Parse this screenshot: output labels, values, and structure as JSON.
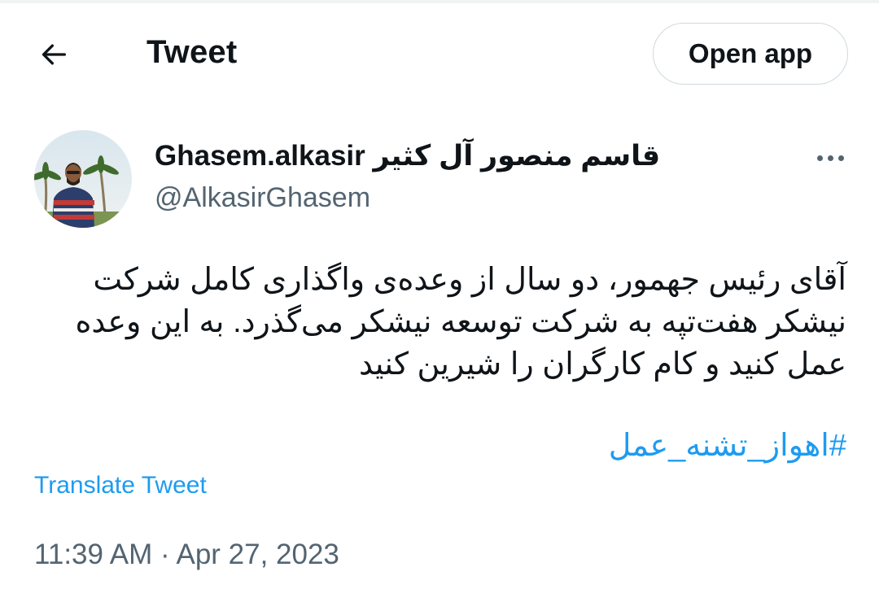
{
  "header": {
    "back_icon": "arrow-left-icon",
    "title": "Tweet",
    "open_app_label": "Open app"
  },
  "author": {
    "display_name_latin": "Ghasem.alkasir",
    "display_name_persian": "قاسم منصور آل کثیر",
    "handle": "@AlkasirGhasem",
    "avatar_icon": "profile-photo",
    "more_icon": "more-dots-icon"
  },
  "tweet": {
    "text": "آقای رئیس جهمور، دو سال از وعده‌ی واگذاری کامل شرکت نیشکر هفت‌تپه به شرکت توسعه نیشکر می‌گذرد. به این وعده عمل کنید و کام کارگران را شیرین کنید",
    "hashtag": "#اهواز_تشنه_عمل",
    "translate_label": "Translate Tweet",
    "time": "11:39 AM",
    "separator": "·",
    "date": "Apr 27, 2023"
  },
  "colors": {
    "accent": "#1d9bf0",
    "text_primary": "#0f1419",
    "text_secondary": "#536471",
    "border": "#cfd9de"
  }
}
